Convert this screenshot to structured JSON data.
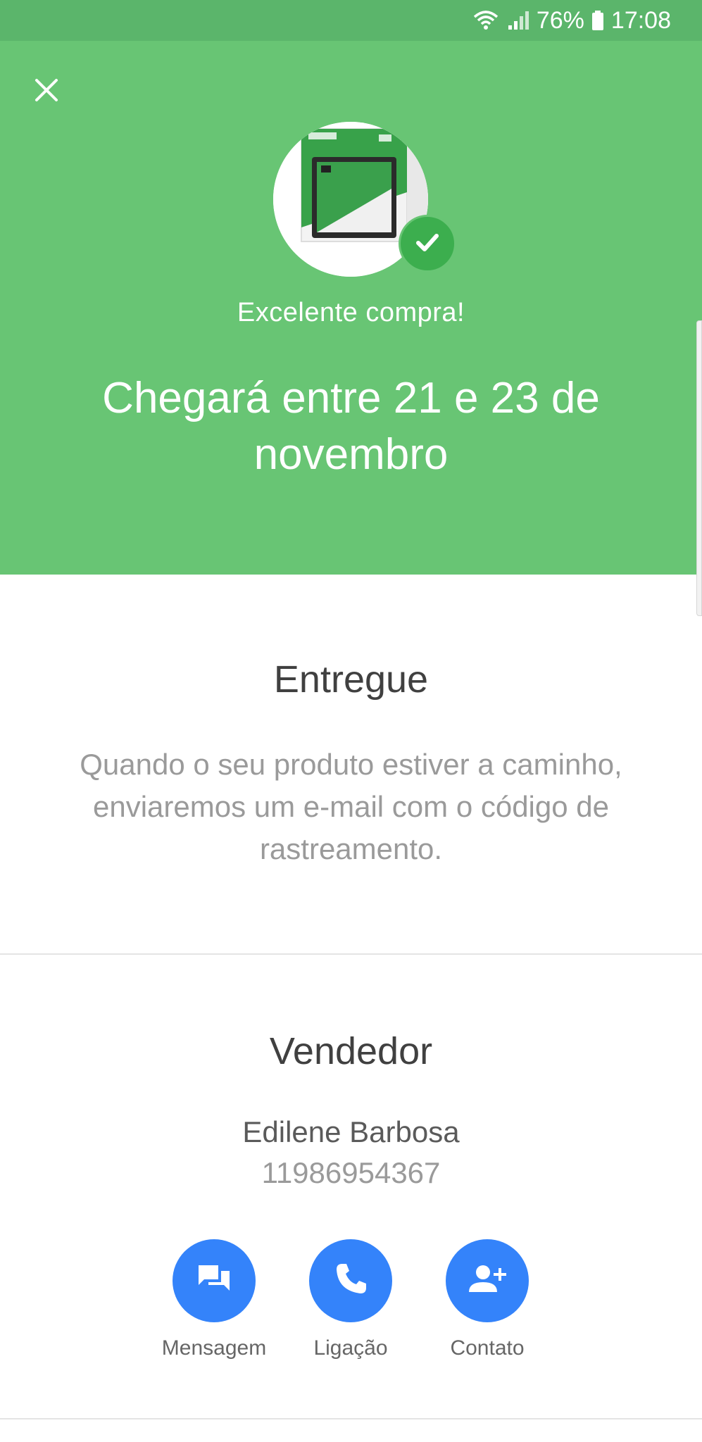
{
  "status_bar": {
    "battery_percent": "76%",
    "time": "17:08",
    "icons": [
      "wifi-icon",
      "signal-icon",
      "battery-icon"
    ]
  },
  "hero": {
    "close_icon": "close-icon",
    "subtitle": "Excelente compra!",
    "title": "Chegará entre 21 e 23 de novembro",
    "background_color": "#68c574",
    "badge_icon": "check-icon"
  },
  "delivery": {
    "title": "Entregue",
    "text": "Quando o seu produto estiver a caminho, enviaremos um e-mail com o código de rastreamento."
  },
  "seller": {
    "title": "Vendedor",
    "name": "Edilene Barbosa",
    "phone": "11986954367",
    "actions": [
      {
        "label": "Mensagem",
        "icon": "message-icon"
      },
      {
        "label": "Ligação",
        "icon": "phone-icon"
      },
      {
        "label": "Contato",
        "icon": "add-contact-icon"
      }
    ],
    "accent_color": "#3483fa"
  }
}
